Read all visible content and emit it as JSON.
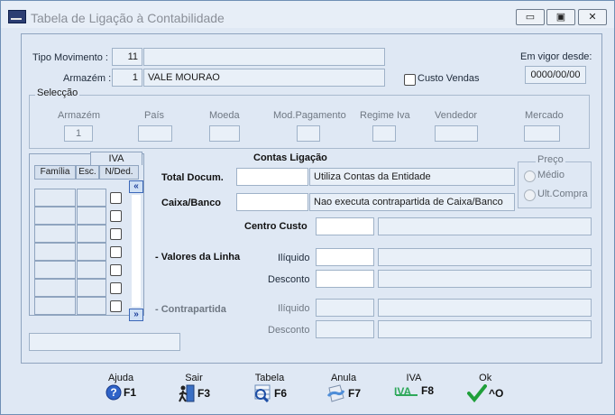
{
  "window": {
    "title": "Tabela de Ligação à Contabilidade",
    "buttons": {
      "minimize": "▭",
      "restore": "▣",
      "close": "✕"
    }
  },
  "header": {
    "tipo_movimento_label": "Tipo Movimento :",
    "tipo_movimento_code": "11",
    "tipo_movimento_desc": "",
    "armazem_label": "Armazém :",
    "armazem_code": "1",
    "armazem_desc": "VALE MOURAO",
    "custo_vendas_label": "Custo Vendas",
    "custo_vendas_checked": false,
    "em_vigor_label": "Em vigor desde:",
    "em_vigor_value": "0000/00/00"
  },
  "seleccao": {
    "title": "Selecção",
    "columns": [
      {
        "label": "Armazém",
        "value": "1"
      },
      {
        "label": "País",
        "value": ""
      },
      {
        "label": "Moeda",
        "value": ""
      },
      {
        "label": "Mod.Pagamento",
        "value": ""
      },
      {
        "label": "Regime Iva",
        "value": ""
      },
      {
        "label": "Vendedor",
        "value": ""
      },
      {
        "label": "Mercado",
        "value": ""
      }
    ]
  },
  "iva": {
    "tab_label": "IVA",
    "col_familia": "Família",
    "col_esc": "Esc.",
    "col_nded": "N/Ded.",
    "rows": 7,
    "bottom_field": ""
  },
  "contas": {
    "title": "Contas Ligação",
    "total_docum_label": "Total Docum.",
    "total_docum_value": "",
    "total_docum_desc": "Utiliza Contas da Entidade",
    "caixa_banco_label": "Caixa/Banco",
    "caixa_banco_value": "",
    "caixa_banco_desc": "Nao executa contrapartida de Caixa/Banco",
    "centro_custo_label": "Centro Custo",
    "valores_linha_label": "- Valores da Linha",
    "contrapartida_label": "- Contrapartida",
    "iliquido_label": "Ilíquido",
    "desconto_label": "Desconto"
  },
  "preco": {
    "title": "Preço",
    "options": [
      "Médio",
      "Ult.Compra"
    ]
  },
  "fkeys": [
    {
      "label": "Ajuda",
      "key": "F1",
      "icon": "help-icon"
    },
    {
      "label": "Sair",
      "key": "F3",
      "icon": "exit-icon"
    },
    {
      "label": "Tabela",
      "key": "F6",
      "icon": "table-search-icon"
    },
    {
      "label": "Anula",
      "key": "F7",
      "icon": "cancel-icon"
    },
    {
      "label": "IVA",
      "key": "F8",
      "icon": "iva-icon"
    },
    {
      "label": "Ok",
      "key": "^O",
      "icon": "ok-check-icon"
    }
  ],
  "colors": {
    "accent": "#3b67b8",
    "panel": "#dfe8f4",
    "field": "#e9f0f8"
  }
}
